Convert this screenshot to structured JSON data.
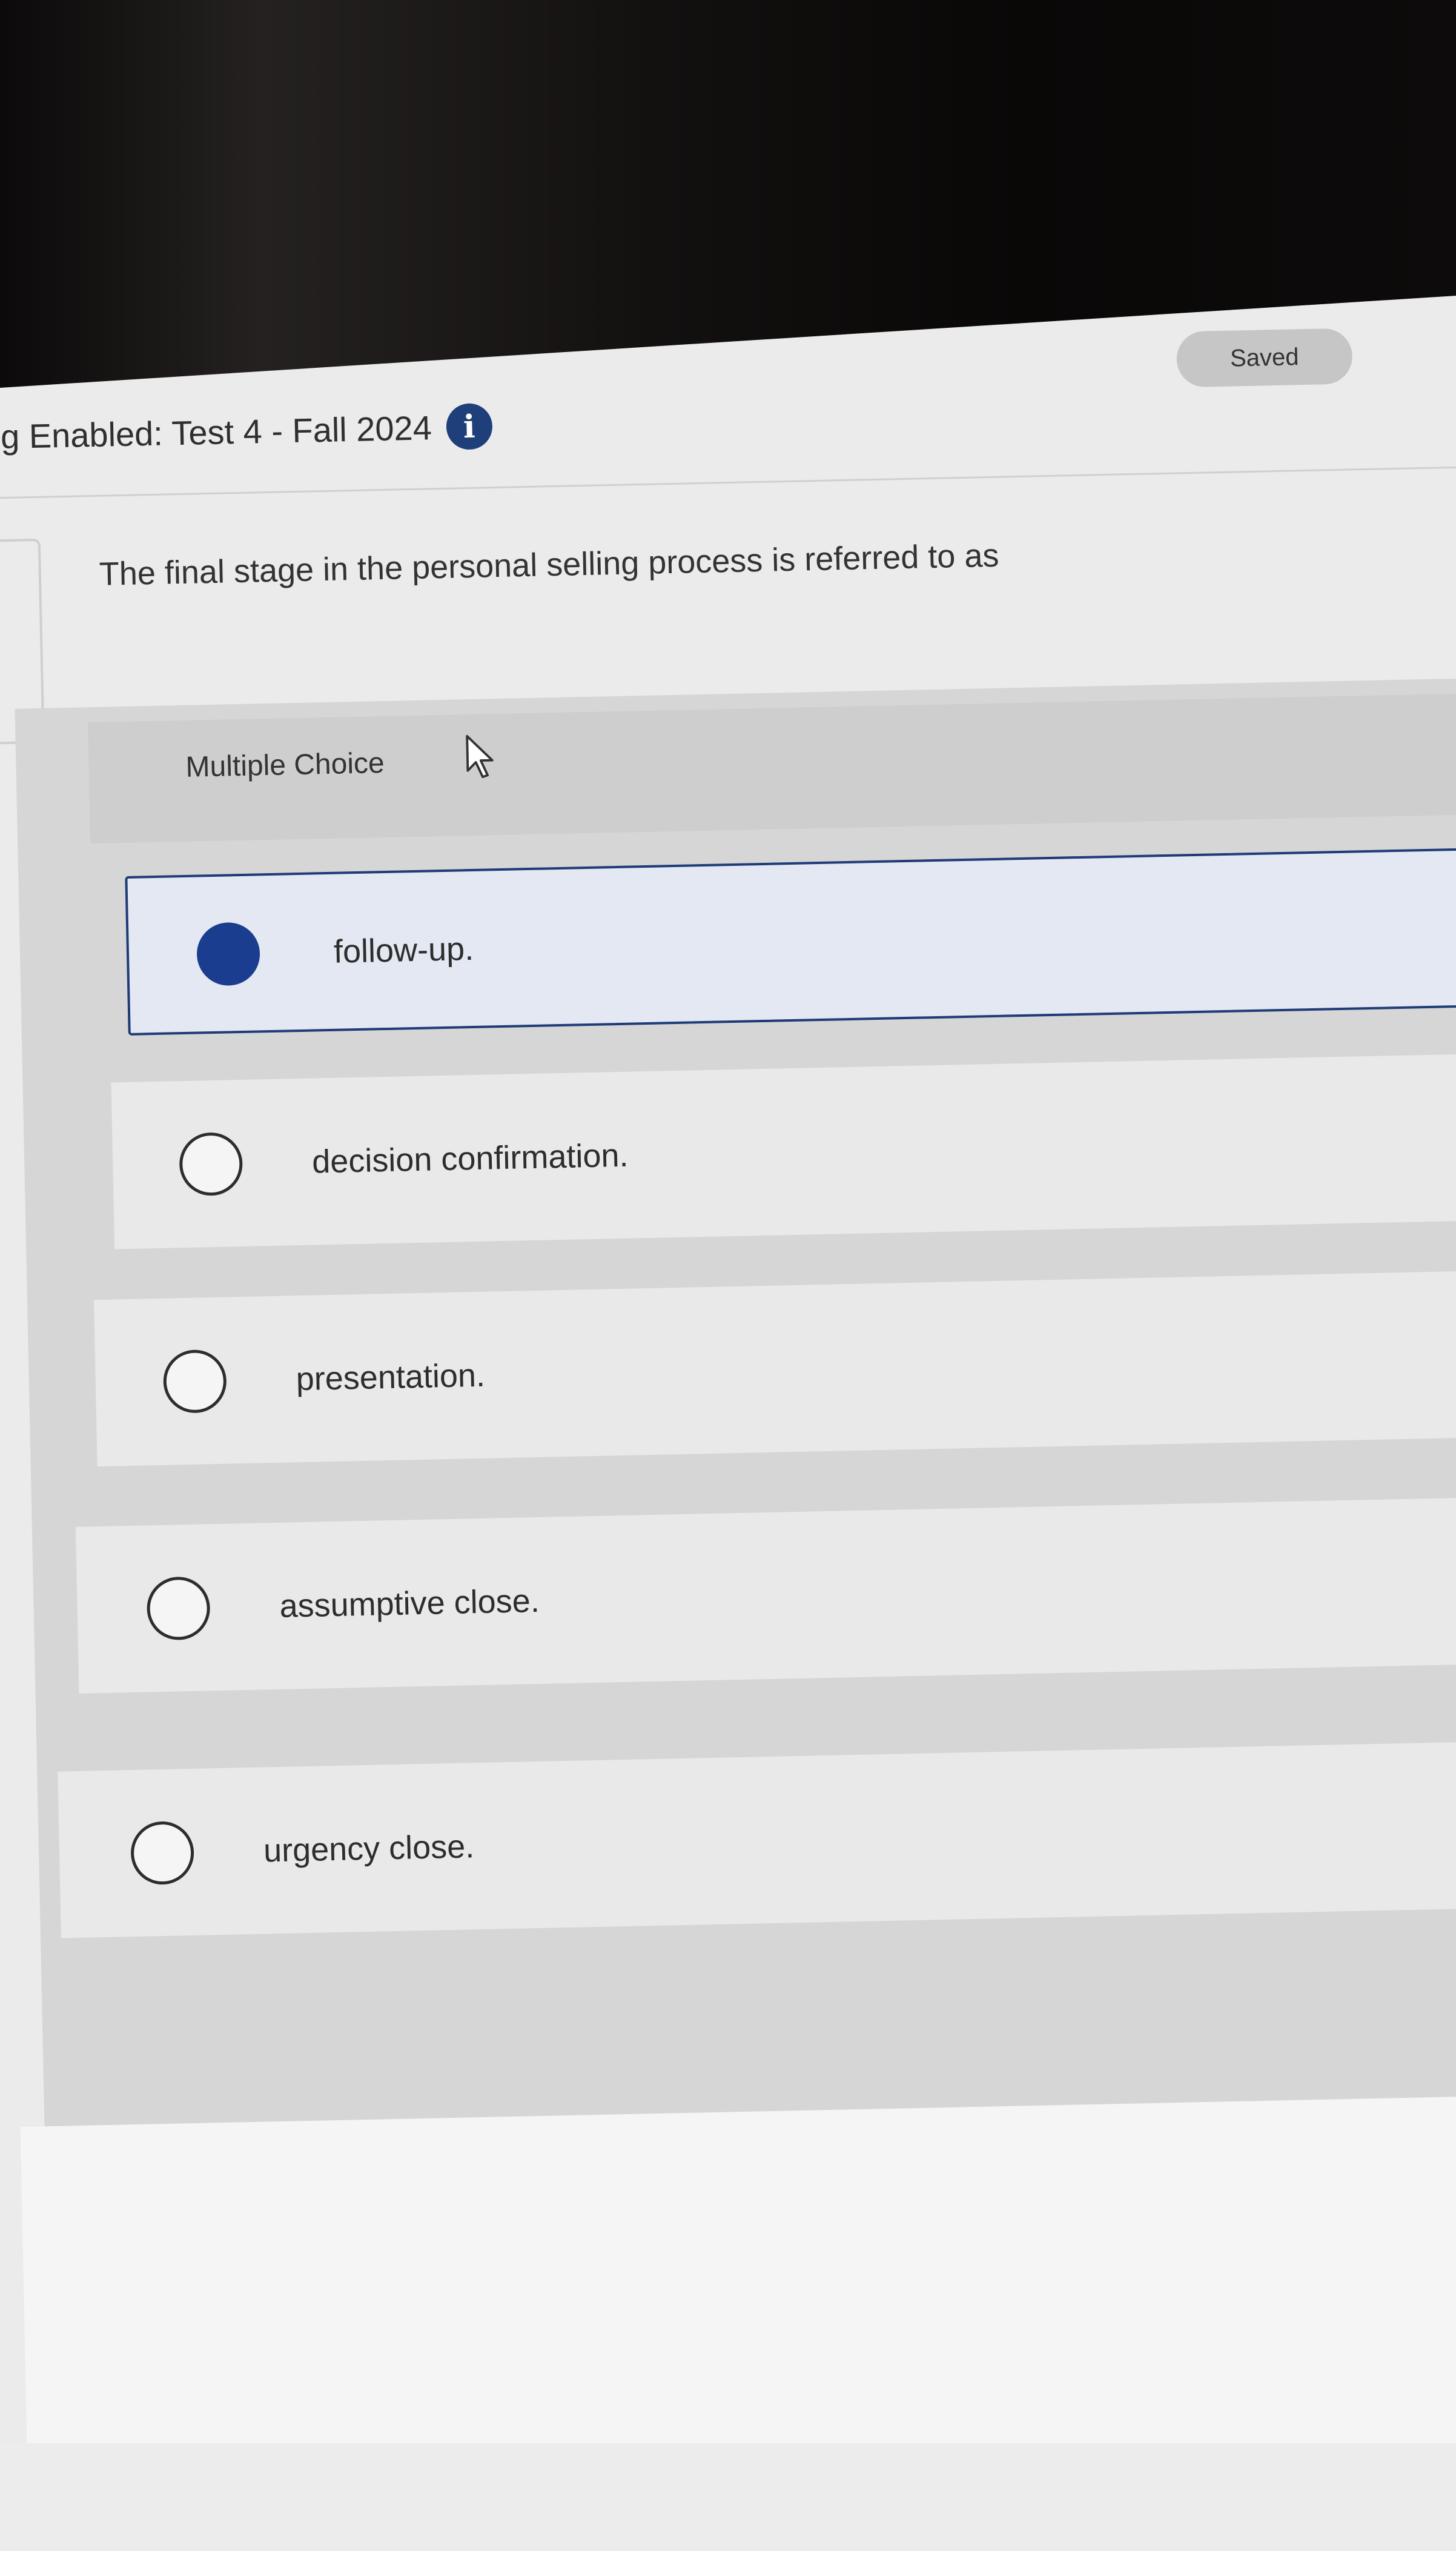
{
  "header": {
    "title": "g Enabled: Test 4 - Fall 2024",
    "status_badge": "Saved"
  },
  "question": {
    "prompt": "The final stage in the personal selling process is referred to as",
    "type_label": "Multiple Choice"
  },
  "options": [
    {
      "label": "follow-up.",
      "selected": true
    },
    {
      "label": "decision confirmation.",
      "selected": false
    },
    {
      "label": "presentation.",
      "selected": false
    },
    {
      "label": "assumptive close.",
      "selected": false
    },
    {
      "label": "urgency close.",
      "selected": false
    }
  ],
  "icons": {
    "info": "info-icon",
    "pointer": "mouse-pointer-icon"
  },
  "colors": {
    "accent_green": "#7ebd45",
    "selected_radio": "#1a3d8f",
    "info_icon": "#1f3f7a",
    "selected_border": "#1f3b78"
  }
}
